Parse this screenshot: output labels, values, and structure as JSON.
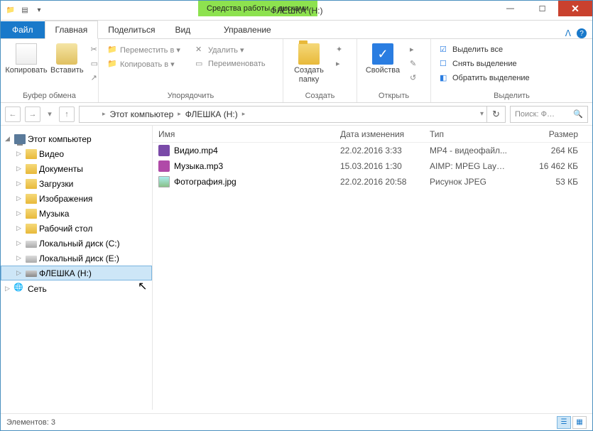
{
  "titlebar": {
    "contextual": "Средства работы с дисками",
    "title": "ФЛЕШКА (H:)"
  },
  "tabs": {
    "file": "Файл",
    "home": "Главная",
    "share": "Поделиться",
    "view": "Вид",
    "manage": "Управление"
  },
  "ribbon": {
    "clipboard": {
      "copy": "Копировать",
      "paste": "Вставить",
      "label": "Буфер обмена"
    },
    "organize": {
      "move_to": "Переместить в ▾",
      "copy_to": "Копировать в ▾",
      "delete": "Удалить ▾",
      "rename": "Переименовать",
      "label": "Упорядочить"
    },
    "new": {
      "new_folder": "Создать\nпапку",
      "label": "Создать"
    },
    "open": {
      "properties": "Свойства",
      "label": "Открыть"
    },
    "select": {
      "select_all": "Выделить все",
      "deselect": "Снять выделение",
      "invert": "Обратить выделение",
      "label": "Выделить"
    }
  },
  "address": {
    "segments": [
      "Этот компьютер",
      "ФЛЕШКА (H:)"
    ]
  },
  "search": {
    "placeholder": "Поиск: Ф…"
  },
  "tree": {
    "root": "Этот компьютер",
    "items": [
      {
        "label": "Видео",
        "icon": "fold"
      },
      {
        "label": "Документы",
        "icon": "fold"
      },
      {
        "label": "Загрузки",
        "icon": "fold"
      },
      {
        "label": "Изображения",
        "icon": "fold"
      },
      {
        "label": "Музыка",
        "icon": "fold"
      },
      {
        "label": "Рабочий стол",
        "icon": "fold"
      },
      {
        "label": "Локальный диск (C:)",
        "icon": "drive"
      },
      {
        "label": "Локальный диск (E:)",
        "icon": "drive"
      },
      {
        "label": "ФЛЕШКА (H:)",
        "icon": "usb",
        "selected": true
      }
    ],
    "network": "Сеть"
  },
  "columns": {
    "name": "Имя",
    "date": "Дата изменения",
    "type": "Тип",
    "size": "Размер"
  },
  "files": [
    {
      "icon": "mp4",
      "name": "Видио.mp4",
      "date": "22.02.2016 3:33",
      "type": "MP4 - видеофайл...",
      "size": "264 КБ"
    },
    {
      "icon": "mp3",
      "name": "Музыка.mp3",
      "date": "15.03.2016 1:30",
      "type": "AIMP: MPEG Laye...",
      "size": "16 462 КБ"
    },
    {
      "icon": "jpg",
      "name": "Фотография.jpg",
      "date": "22.02.2016 20:58",
      "type": "Рисунок JPEG",
      "size": "53 КБ"
    }
  ],
  "status": {
    "count": "Элементов: 3"
  }
}
